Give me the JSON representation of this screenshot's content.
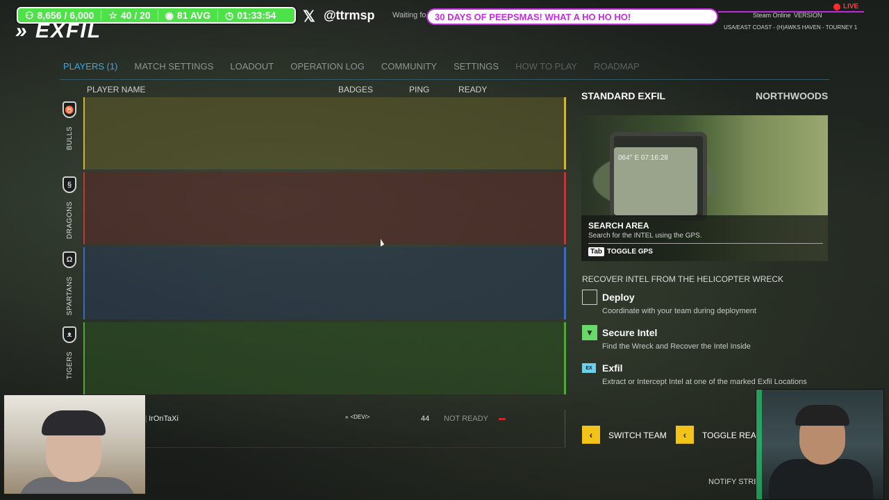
{
  "overlay": {
    "followers": "8,656 / 6,000",
    "stars": "40 / 20",
    "viewers": "81 AVG",
    "uptime": "01:33:54",
    "handle": "@ttrmsp",
    "waiting": "Waiting fo",
    "banner": "30 DAYS OF PEEPSMAS! WHAT A HO HO HO!",
    "live": "LIVE"
  },
  "game": {
    "logo": "EXFIL",
    "steam_status": "Steam Online",
    "version": "VERSION",
    "server": "USA/EAST COAST - (H)AWKS HAVEN - TOURNEY 1"
  },
  "nav": {
    "items": [
      {
        "label": "PLAYERS (1)"
      },
      {
        "label": "MATCH SETTINGS"
      },
      {
        "label": "LOADOUT"
      },
      {
        "label": "OPERATION LOG"
      },
      {
        "label": "COMMUNITY"
      },
      {
        "label": "SETTINGS"
      },
      {
        "label": "HOW TO PLAY"
      },
      {
        "label": "ROADMAP"
      }
    ]
  },
  "table": {
    "headers": {
      "name": "PLAYER NAME",
      "badges": "BADGES",
      "ping": "PING",
      "ready": "READY"
    },
    "teams": [
      "BULLS",
      "DRAGONS",
      "SPARTANS",
      "TIGERS"
    ],
    "players": [
      {
        "name": "] IrOnTaXi",
        "badge": "<DEV/>",
        "ping": "44",
        "ready": "NOT READY"
      }
    ]
  },
  "panel": {
    "mode": "STANDARD EXFIL",
    "map": "NORTHWOODS",
    "gps_readout": "064° E    07:16:28",
    "preview_title": "SEARCH AREA",
    "preview_desc": "Search for the INTEL using the GPS.",
    "tab_key": "Tab",
    "tab_label": "TOGGLE GPS",
    "objective_header": "RECOVER INTEL FROM THE HELICOPTER WRECK",
    "objectives": [
      {
        "title": "Deploy",
        "desc": "Coordinate with your team during deployment"
      },
      {
        "title": "Secure Intel",
        "desc": "Find the Wreck and Recover the Intel Inside"
      },
      {
        "title": "Exfil",
        "desc": "Extract or Intercept Intel at one of the marked Exfil Locations",
        "tag": "EX"
      }
    ],
    "buttons": {
      "switch_team": "SWITCH TEAM",
      "toggle_ready": "TOGGLE READ"
    },
    "notify": "NOTIFY STREA"
  },
  "colors": {
    "accent_blue": "#3fa9e3",
    "stats_green": "#4fe14a",
    "banner_purple": "#c428e0",
    "button_yellow": "#f2c318",
    "bulls": "#d2b43a",
    "dragons": "#b83a3a",
    "spartans": "#3a6ab8",
    "tigers": "#52a63a"
  }
}
